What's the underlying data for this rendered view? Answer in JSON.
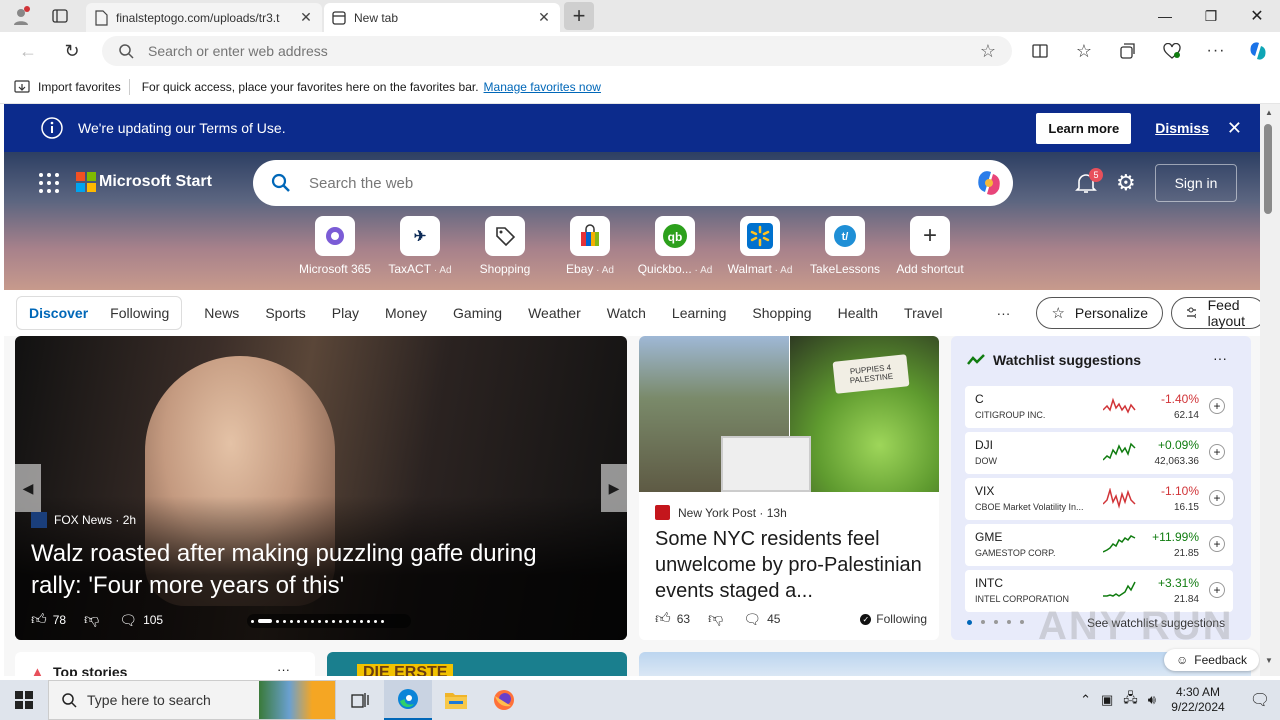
{
  "tabs": [
    {
      "title": "finalsteptogo.com/uploads/tr3.t"
    },
    {
      "title": "New tab"
    }
  ],
  "address": {
    "placeholder": "Search or enter web address"
  },
  "favorites": {
    "import_label": "Import favorites",
    "hint": "For quick access, place your favorites here on the favorites bar.",
    "manage_link": "Manage favorites now"
  },
  "notice": {
    "text": "We're updating our Terms of Use.",
    "learn_more": "Learn more",
    "dismiss": "Dismiss"
  },
  "msstart": {
    "brand": "Microsoft Start",
    "search_placeholder": "Search the web",
    "notif_count": "5",
    "sign_in": "Sign in"
  },
  "shortcuts": [
    {
      "label": "Microsoft 365",
      "icon": "microsoft-365-icon"
    },
    {
      "label": "TaxACT",
      "ad": "Ad",
      "icon": "taxact-icon"
    },
    {
      "label": "Shopping",
      "icon": "tag-icon"
    },
    {
      "label": "Ebay",
      "ad": "Ad",
      "icon": "ebay-bag-icon"
    },
    {
      "label": "Quickbo...",
      "ad": "Ad",
      "icon": "quickbooks-icon"
    },
    {
      "label": "Walmart",
      "ad": "Ad",
      "icon": "walmart-icon"
    },
    {
      "label": "TakeLessons",
      "icon": "takelessons-icon"
    },
    {
      "label": "Add shortcut",
      "icon": "plus-icon"
    }
  ],
  "nav": {
    "discover": "Discover",
    "following": "Following",
    "items": [
      "News",
      "Sports",
      "Play",
      "Money",
      "Gaming",
      "Weather",
      "Watch",
      "Learning",
      "Shopping",
      "Health",
      "Travel"
    ],
    "more": "···",
    "personalize": "Personalize",
    "feed_layout": "Feed layout"
  },
  "main_story": {
    "source": "FOX News",
    "age": "2h",
    "headline": "Walz roasted after making puzzling gaffe during rally: 'Four more years of this'",
    "likes": "78",
    "comments": "105"
  },
  "side_story": {
    "source": "New York Post",
    "age": "13h",
    "headline": "Some NYC residents feel unwelcome by pro-Palestinian events staged a...",
    "likes": "63",
    "comments": "45",
    "following": "Following",
    "sign_text": "PUPPIES 4 PALESTINE"
  },
  "watchlist": {
    "title": "Watchlist suggestions",
    "see_more": "See watchlist suggestions",
    "stocks": [
      {
        "symbol": "C",
        "name": "CITIGROUP INC.",
        "change": "-1.40%",
        "price": "62.14",
        "up": false
      },
      {
        "symbol": "DJI",
        "name": "DOW",
        "change": "+0.09%",
        "price": "42,063.36",
        "up": true
      },
      {
        "symbol": "VIX",
        "name": "CBOE Market Volatility In...",
        "change": "-1.10%",
        "price": "16.15",
        "up": false
      },
      {
        "symbol": "GME",
        "name": "GAMESTOP CORP.",
        "change": "+11.99%",
        "price": "21.85",
        "up": true
      },
      {
        "symbol": "INTC",
        "name": "INTEL CORPORATION",
        "change": "+3.31%",
        "price": "21.84",
        "up": true
      }
    ]
  },
  "bottom": {
    "top_stories": "Top stories",
    "promo": "DIE ERSTE",
    "feedback": "Feedback"
  },
  "watermark": "ANY RUN",
  "taskbar": {
    "search_placeholder": "Type here to search",
    "time": "4:30 AM",
    "date": "9/22/2024"
  },
  "colors": {
    "accent": "#0067b8",
    "notice_bg": "#0c2b8c",
    "down": "#d13438",
    "up": "#107c10"
  }
}
